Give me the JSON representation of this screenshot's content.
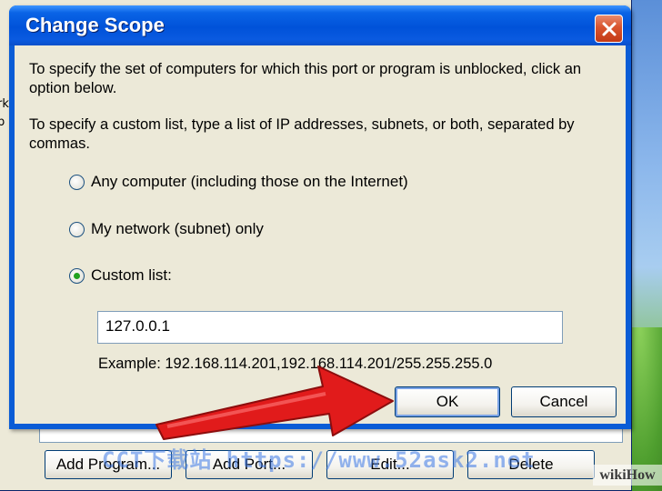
{
  "dialog": {
    "title": "Change Scope",
    "paragraph1": "To specify the set of computers for which this port or program is unblocked, click an option below.",
    "paragraph2": "To specify a custom list, type a list of IP addresses, subnets, or both, separated by commas.",
    "options": [
      {
        "label": "Any computer (including those on the Internet)",
        "selected": false
      },
      {
        "label": "My network (subnet) only",
        "selected": false
      },
      {
        "label": "Custom list:",
        "selected": true
      }
    ],
    "custom_list_value": "127.0.0.1",
    "example_text": "Example: 192.168.114.201,192.168.114.201/255.255.255.0",
    "ok_label": "OK",
    "cancel_label": "Cancel"
  },
  "parent_window": {
    "edge_text": [
      "rk",
      "p"
    ],
    "buttons": [
      "Add Program...",
      "Add Port...",
      "Edit...",
      "Delete"
    ]
  },
  "overlays": {
    "watermark": "CCT下载站 https://www.52ask2.net",
    "wikihow": "wikiHow",
    "arrow_color": "#e11b1b"
  },
  "icons": {
    "close": "close-icon",
    "radio_selected_dot_color": "#21a121"
  }
}
